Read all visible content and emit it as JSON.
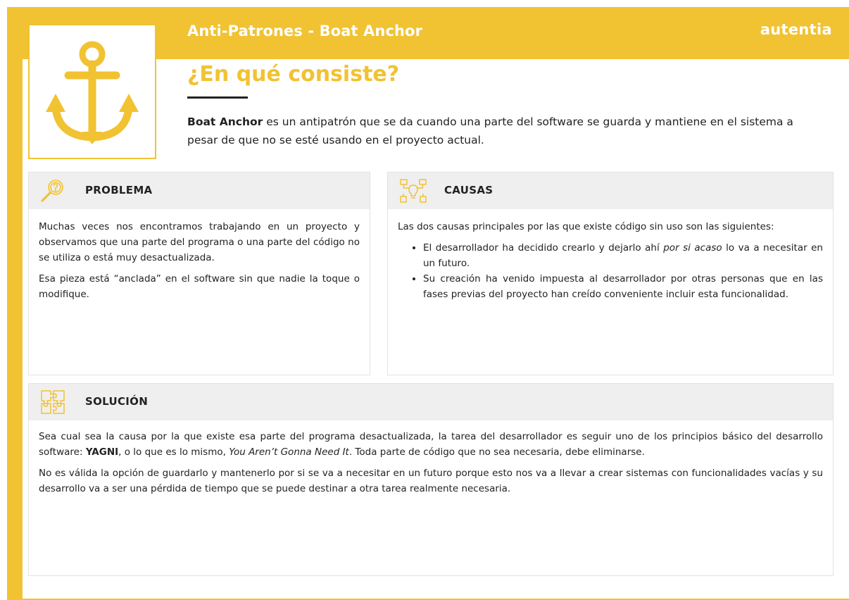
{
  "header": {
    "title": "Anti-Patrones - Boat Anchor",
    "logo": "autentia"
  },
  "intro": {
    "heading": "¿En qué consiste?",
    "bold_term": "Boat Anchor",
    "text": " es un antipatrón que se da cuando una parte del software se guarda y mantiene en el sistema a pesar de que no se esté usando en el proyecto actual."
  },
  "problema": {
    "title": "PROBLEMA",
    "icon": "magnifier-question-icon",
    "paragraph1": "Muchas veces nos encontramos trabajando en un proyecto y observamos que una parte del programa o una parte del código no se utiliza o está muy desactualizada.",
    "paragraph2": "Esa pieza está “anclada” en el software sin que nadie la toque o modifique."
  },
  "causas": {
    "title": "CAUSAS",
    "icon": "flowchart-bulb-icon",
    "intro": "Las dos causas principales por las que existe código sin uso son las siguientes:",
    "item1_a": "El desarrollador ha decidido crearlo y dejarlo ahí ",
    "item1_em": "por si acaso",
    "item1_b": " lo va a necesitar en un futuro.",
    "item2": "Su creación ha venido impuesta al desarrollador por otras personas que en las fases previas del proyecto han creído conveniente incluir esta funcionalidad."
  },
  "solucion": {
    "title": "SOLUCIÓN",
    "icon": "puzzle-icon",
    "p1_a": "Sea cual sea la causa por la que existe esa parte del programa desactualizada, la tarea del desarrollador es seguir uno de los principios básico del desarrollo software: ",
    "p1_bold": "YAGNI",
    "p1_b": ", o lo que es lo mismo, ",
    "p1_em": "You Aren’t Gonna Need It",
    "p1_c": ". Toda parte de código que no sea necesaria, debe eliminarse.",
    "p2": "No es válida la opción de guardarlo y mantenerlo por si se va a necesitar en un futuro porque esto nos va a llevar a crear sistemas con funcionalidades vacías y su desarrollo va a ser una pérdida de tiempo que se puede destinar a otra tarea realmente necesaria."
  },
  "colors": {
    "accent": "#f1c232",
    "panel_header": "#efefef",
    "text": "#222222"
  }
}
